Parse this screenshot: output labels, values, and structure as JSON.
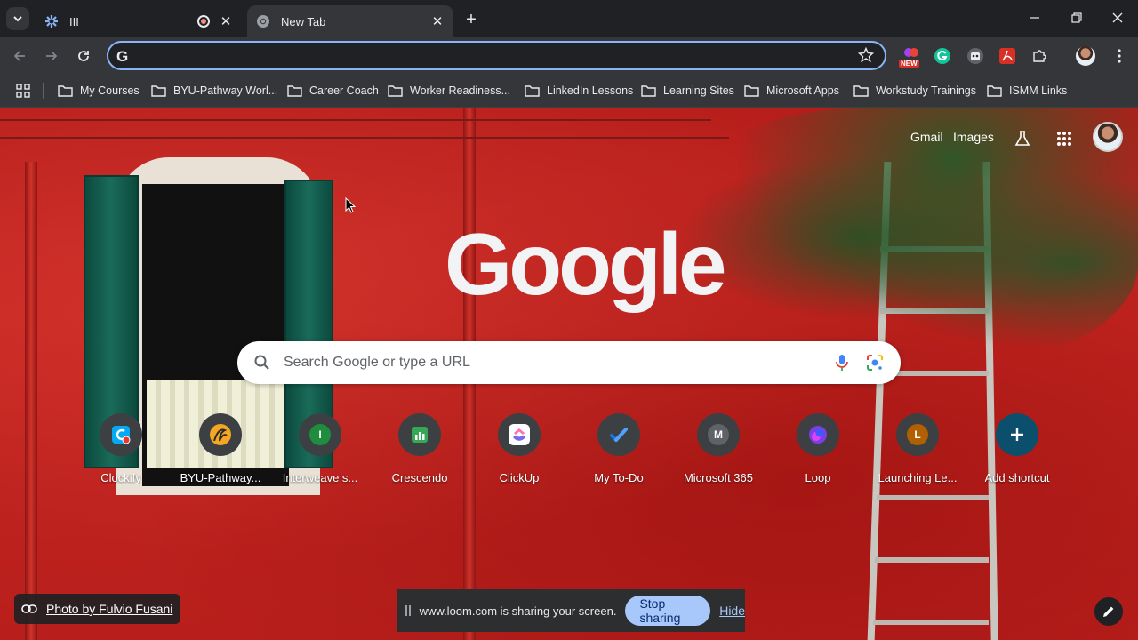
{
  "tabs": [
    {
      "title": "III",
      "recording": true
    },
    {
      "title": "New Tab",
      "active": true
    }
  ],
  "toolbar": {
    "omnibox_value": "",
    "ext_new_badge": "NEW"
  },
  "bookmarks": [
    {
      "label": "My Courses"
    },
    {
      "label": "BYU-Pathway Worl..."
    },
    {
      "label": "Career Coach"
    },
    {
      "label": "Worker Readiness..."
    },
    {
      "label": "LinkedIn Lessons"
    },
    {
      "label": "Learning Sites"
    },
    {
      "label": "Microsoft Apps"
    },
    {
      "label": "Workstudy Trainings"
    },
    {
      "label": "ISMM Links"
    }
  ],
  "ntp": {
    "gmail": "Gmail",
    "images": "Images",
    "logo": "Google",
    "search_placeholder": "Search Google or type a URL",
    "shortcuts": [
      {
        "label": "Clockify"
      },
      {
        "label": "BYU-Pathway..."
      },
      {
        "label": "Interweave s...",
        "letter": "I"
      },
      {
        "label": "Crescendo"
      },
      {
        "label": "ClickUp"
      },
      {
        "label": "My To-Do"
      },
      {
        "label": "Microsoft 365",
        "letter": "M"
      },
      {
        "label": "Loop"
      },
      {
        "label": "Launching Le...",
        "letter": "L"
      },
      {
        "label": "Add shortcut"
      }
    ],
    "attribution": "Photo by Fulvio Fusani"
  },
  "share_bar": {
    "text": "www.loom.com is sharing your screen.",
    "stop_label": "Stop sharing",
    "hide_label": "Hide"
  },
  "colors": {
    "accent": "#8ab4f8",
    "wall_red": "#c42520",
    "stop_button": "#a8c7fa"
  }
}
